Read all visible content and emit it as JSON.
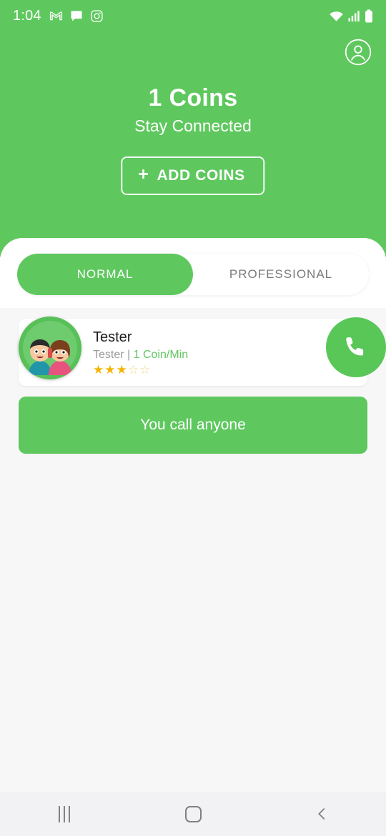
{
  "status_bar": {
    "time": "1:04",
    "left_icons": [
      "gmail-icon",
      "message-icon",
      "instagram-icon"
    ],
    "right_icons": [
      "wifi-icon",
      "signal-icon",
      "battery-icon"
    ]
  },
  "header": {
    "profile_icon": "account-circle-icon",
    "coins_label": "1 Coins",
    "tagline": "Stay Connected",
    "add_coins_plus": "+",
    "add_coins_label": "ADD COINS"
  },
  "tabs": [
    {
      "label": "NORMAL",
      "active": true
    },
    {
      "label": "PROFESSIONAL",
      "active": false
    }
  ],
  "contacts": [
    {
      "avatar_icon": "couple-on-phone-avatar",
      "name": "Tester",
      "subtitle_owner": "Tester | ",
      "subtitle_rate": "1 Coin/Min",
      "rating": 3,
      "rating_max": 5,
      "stars_filled": "★★★",
      "stars_empty": "☆☆",
      "call_icon": "phone-icon"
    }
  ],
  "cta": {
    "label": "You call anyone"
  },
  "nav_bar": {
    "recents_icon": "recents-icon",
    "home_icon": "home-icon",
    "back_icon": "back-icon"
  },
  "colors": {
    "brand_green": "#5ec85e",
    "call_green": "#58c758",
    "rate_green": "#62c762",
    "star_gold": "#f5b301",
    "sheet_bg": "#f7f7f8",
    "nav_bg": "#f2f2f4"
  }
}
